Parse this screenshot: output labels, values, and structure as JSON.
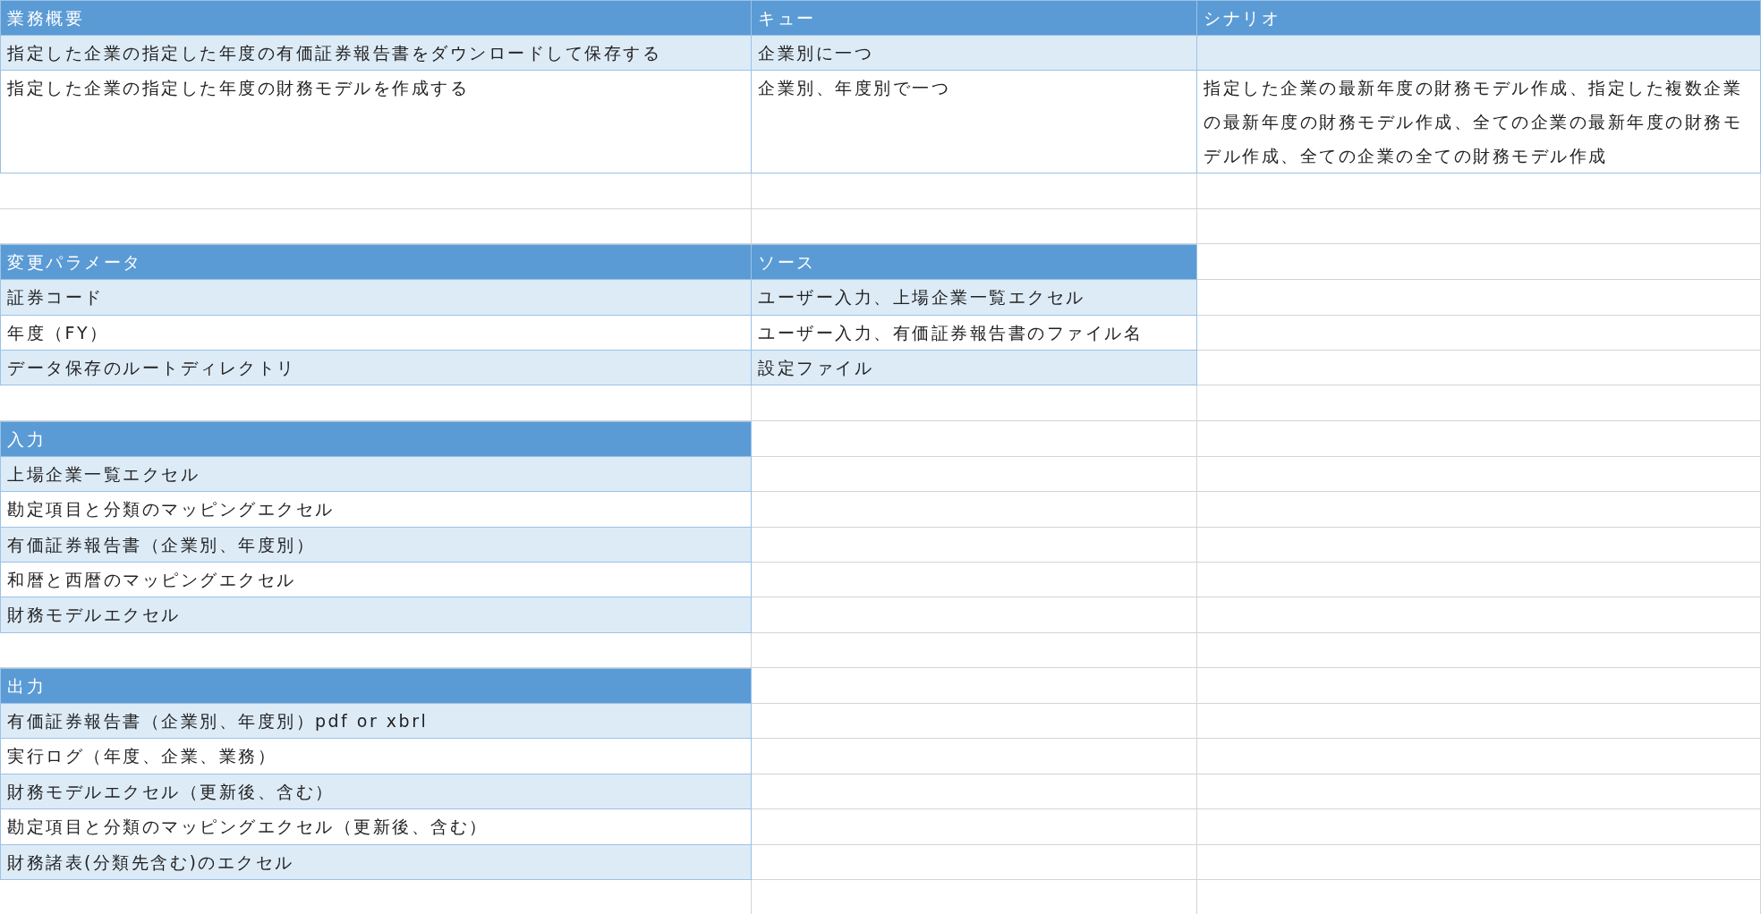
{
  "sheet": {
    "blocks": [
      {
        "kind": "table",
        "columns": [
          "業務概要",
          "キュー",
          "シナリオ"
        ],
        "rows": [
          {
            "cells": [
              "指定した企業の指定した年度の有価証券報告書をダウンロードして保存する",
              "企業別に一つ"
            ]
          },
          {
            "cells": [
              "指定した企業の指定した年度の財務モデルを作成する",
              "企業別、年度別で一つ",
              "指定した企業の最新年度の財務モデル作成、指定した複数企業の最新年度の財務モデル作成、全ての企業の最新年度の財務モデル作成、全ての企業の全ての財務モデル作成"
            ]
          }
        ]
      },
      {
        "kind": "blank"
      },
      {
        "kind": "blank"
      },
      {
        "kind": "table",
        "columns": [
          "変更パラメータ",
          "ソース"
        ],
        "rows": [
          {
            "cells": [
              "証券コード",
              "ユーザー入力、上場企業一覧エクセル"
            ]
          },
          {
            "cells": [
              "年度（FY）",
              "ユーザー入力、有価証券報告書のファイル名"
            ]
          },
          {
            "cells": [
              "データ保存のルートディレクトリ",
              "設定ファイル"
            ]
          }
        ]
      },
      {
        "kind": "blank"
      },
      {
        "kind": "table",
        "columns": [
          "入力"
        ],
        "rows": [
          {
            "cells": [
              "上場企業一覧エクセル"
            ]
          },
          {
            "cells": [
              "勘定項目と分類のマッピングエクセル"
            ]
          },
          {
            "cells": [
              "有価証券報告書（企業別、年度別）"
            ]
          },
          {
            "cells": [
              "和暦と西暦のマッピングエクセル"
            ]
          },
          {
            "cells": [
              "財務モデルエクセル"
            ]
          }
        ]
      },
      {
        "kind": "blank"
      },
      {
        "kind": "table",
        "columns": [
          "出力"
        ],
        "rows": [
          {
            "cells": [
              "有価証券報告書（企業別、年度別）pdf or xbrl"
            ]
          },
          {
            "cells": [
              "実行ログ（年度、企業、業務）"
            ]
          },
          {
            "cells": [
              "財務モデルエクセル（更新後、含む）"
            ]
          },
          {
            "cells": [
              "勘定項目と分類のマッピングエクセル（更新後、含む）"
            ]
          },
          {
            "cells": [
              "財務諸表(分類先含む)のエクセル"
            ]
          }
        ]
      },
      {
        "kind": "blank"
      }
    ]
  }
}
